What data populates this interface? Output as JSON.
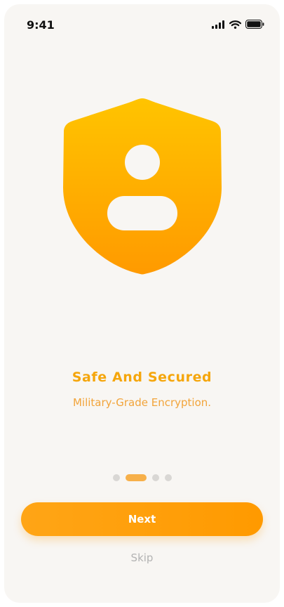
{
  "status_bar": {
    "time": "9:41",
    "icons": [
      "signal-icon",
      "wifi-icon",
      "battery-icon"
    ]
  },
  "onboarding": {
    "illustration": "shield-user-icon",
    "title": "Safe And Secured",
    "subtitle": "Military-Grade Encryption.",
    "pagination": {
      "total": 4,
      "active_index": 1
    }
  },
  "actions": {
    "next_label": "Next",
    "skip_label": "Skip"
  },
  "colors": {
    "accent": "#FF9F00",
    "accent_light": "#FFC400",
    "title": "#F5A60C",
    "background": "#F8F6F3",
    "skip": "#B3B3B3"
  }
}
